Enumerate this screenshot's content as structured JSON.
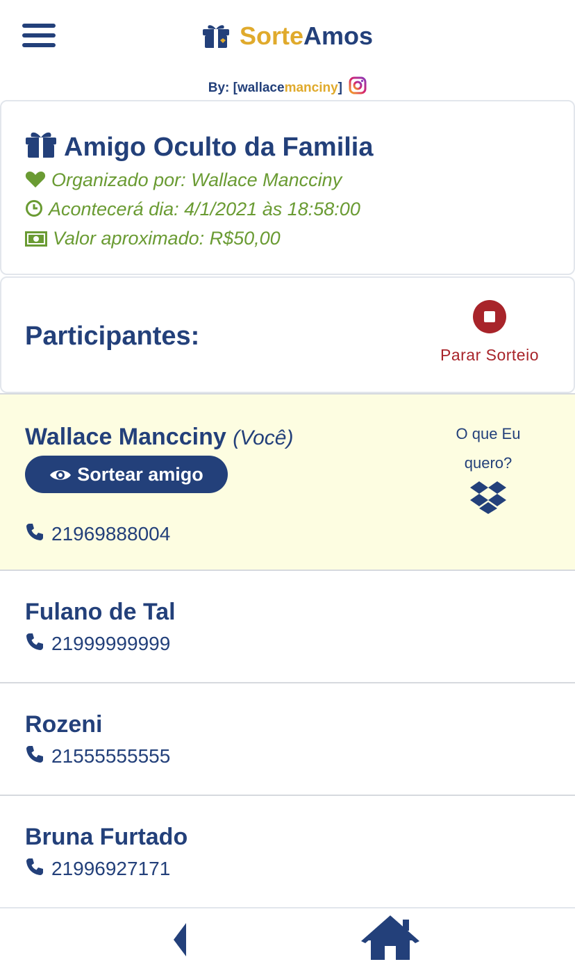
{
  "header": {
    "brand_part1": "Sorte",
    "brand_part2": "Amos",
    "byline_prefix": "By: [wallace",
    "byline_highlight": "manciny",
    "byline_suffix": "]"
  },
  "event": {
    "title": "Amigo Oculto da Familia",
    "organizer": "Organizado por: Wallace Mancciny",
    "date": "Acontecerá dia: 4/1/2021 às 18:58:00",
    "value": "Valor aproximado: R$50,00"
  },
  "participants_section": {
    "title": "Participantes:",
    "stop_label": "Parar Sorteio"
  },
  "participants": [
    {
      "name": "Wallace Mancciny",
      "you_label": "(Você)",
      "phone": "21969888004",
      "action_label": "Sortear amigo",
      "wish_label": "O que Eu quero?"
    },
    {
      "name": "Fulano de Tal",
      "phone": "21999999999"
    },
    {
      "name": "Rozeni",
      "phone": "21555555555"
    },
    {
      "name": "Bruna Furtado",
      "phone": "21996927171"
    }
  ],
  "colors": {
    "primary": "#23407a",
    "gold": "#e0aa2c",
    "green": "#6a9b33",
    "danger": "#a8242a",
    "highlight_row": "#fdfde1"
  },
  "icons": {
    "menu": "hamburger-icon",
    "brand": "gift-icon",
    "social": "instagram-icon",
    "organizer": "heart-icon",
    "date": "clock-icon",
    "value": "money-bill-icon",
    "stop": "stop-circle-icon",
    "draw": "eye-icon",
    "wish": "dropbox-icon",
    "phone": "phone-icon",
    "back": "back-arrow-icon",
    "home": "home-icon"
  }
}
